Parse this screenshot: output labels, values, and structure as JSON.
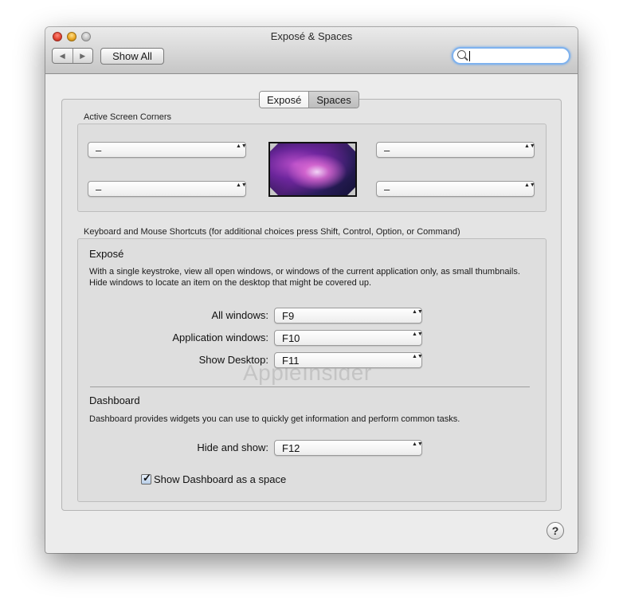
{
  "window": {
    "title": "Exposé & Spaces",
    "back_icon": "◀",
    "forward_icon": "▶",
    "show_all_label": "Show All",
    "search": {
      "value": "",
      "placeholder": ""
    }
  },
  "tabs": [
    {
      "label": "Exposé",
      "selected": true
    },
    {
      "label": "Spaces",
      "selected": false
    }
  ],
  "active_corners": {
    "label": "Active Screen Corners",
    "top_left": "–",
    "top_right": "–",
    "bottom_left": "–",
    "bottom_right": "–"
  },
  "shortcuts": {
    "label": "Keyboard and Mouse Shortcuts (for additional choices press Shift, Control, Option, or Command)",
    "expose": {
      "title": "Exposé",
      "description": "With a single keystroke, view all open windows, or windows of the current application only, as small thumbnails. Hide windows to locate an item on the desktop that might be covered up.",
      "all_windows": {
        "label": "All windows:",
        "value": "F9"
      },
      "application_windows": {
        "label": "Application windows:",
        "value": "F10"
      },
      "show_desktop": {
        "label": "Show Desktop:",
        "value": "F11"
      }
    },
    "dashboard": {
      "title": "Dashboard",
      "description": "Dashboard provides widgets you can use to quickly get information and perform common tasks.",
      "hide_and_show": {
        "label": "Hide and show:",
        "value": "F12"
      },
      "show_as_space": {
        "label": "Show Dashboard as a space",
        "checked": true,
        "check_glyph": "✓"
      }
    }
  },
  "watermark": "AppleInsider",
  "help_label": "?",
  "popup_arrows": "▲▼"
}
